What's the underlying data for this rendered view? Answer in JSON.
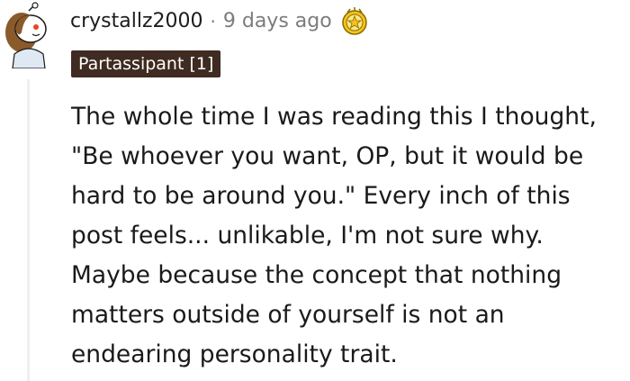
{
  "comment": {
    "username": "crystallz2000",
    "separator": "·",
    "timestamp": "9 days ago",
    "flair": "Partassipant [1]",
    "award_icon": "gold-award-icon",
    "avatar_icon": "snoo-avatar-icon",
    "body": "The whole time I was reading this I thought, \"Be whoever you want, OP, but it would be hard to be around you.\" Every inch of this post feels... unlikable, I'm not sure why. Maybe because the concept that nothing matters outside of yourself is not an endearing personality trait."
  },
  "colors": {
    "flair_bg": "#3f2b21",
    "meta_text": "#7c7c7c",
    "thread_line": "#edeff1",
    "award_gold": "#f5c518"
  }
}
